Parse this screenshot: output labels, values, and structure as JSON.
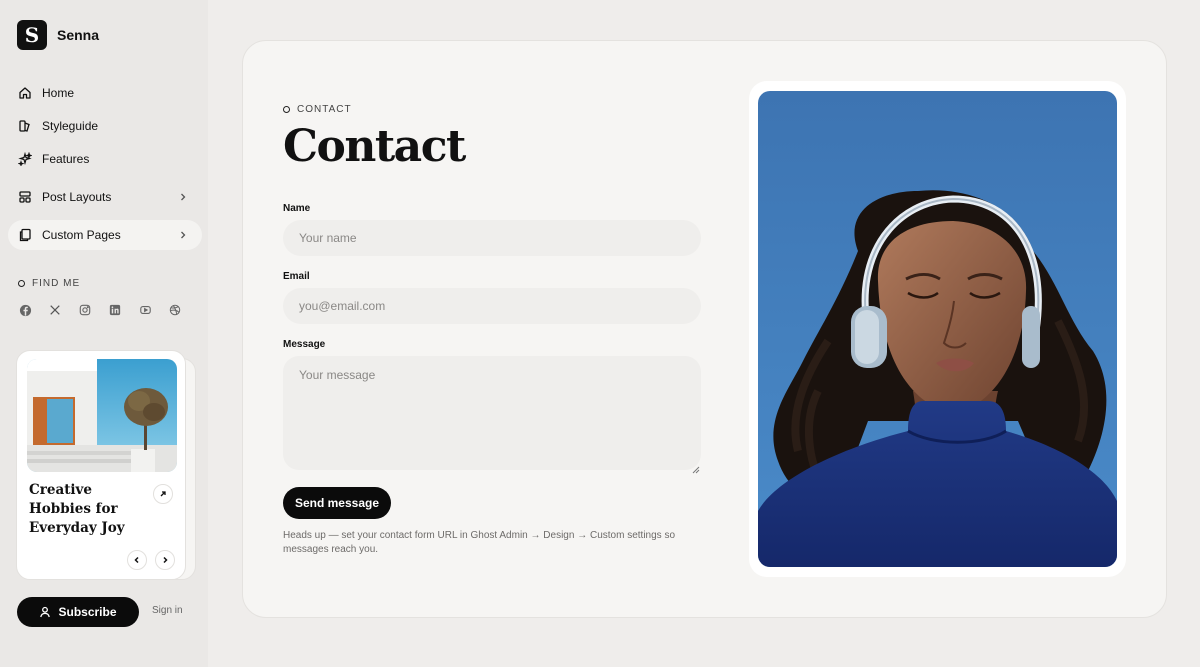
{
  "brand": {
    "name": "Senna",
    "logo_letter": "S"
  },
  "nav": {
    "items": [
      {
        "label": "Home",
        "icon": "home-icon"
      },
      {
        "label": "Styleguide",
        "icon": "styleguide-icon"
      },
      {
        "label": "Features",
        "icon": "sparkles-icon"
      },
      {
        "label": "Post Layouts",
        "icon": "layout-icon",
        "has_submenu": true
      },
      {
        "label": "Custom Pages",
        "icon": "pages-icon",
        "has_submenu": true,
        "active": true
      }
    ]
  },
  "find_me": {
    "label": "FIND ME",
    "socials": [
      "facebook-icon",
      "x-icon",
      "instagram-icon",
      "linkedin-icon",
      "youtube-icon",
      "dribbble-icon"
    ]
  },
  "featured_card": {
    "title": "Creative Hobbies for Everyday Joy"
  },
  "footer": {
    "subscribe_label": "Subscribe",
    "signin_label": "Sign in"
  },
  "page": {
    "eyebrow": "CONTACT",
    "title": "Contact",
    "form": {
      "name_label": "Name",
      "name_placeholder": "Your name",
      "email_label": "Email",
      "email_placeholder": "you@email.com",
      "message_label": "Message",
      "message_placeholder": "Your message",
      "submit_label": "Send message"
    },
    "note": "Heads up — set your contact form URL in Ghost Admin → Design → Custom settings so messages reach you."
  },
  "colors": {
    "accent": "#0b0b0b",
    "background": "#efedeb",
    "panel": "#f6f5f3",
    "photo_sky": "#3f7fbd"
  }
}
